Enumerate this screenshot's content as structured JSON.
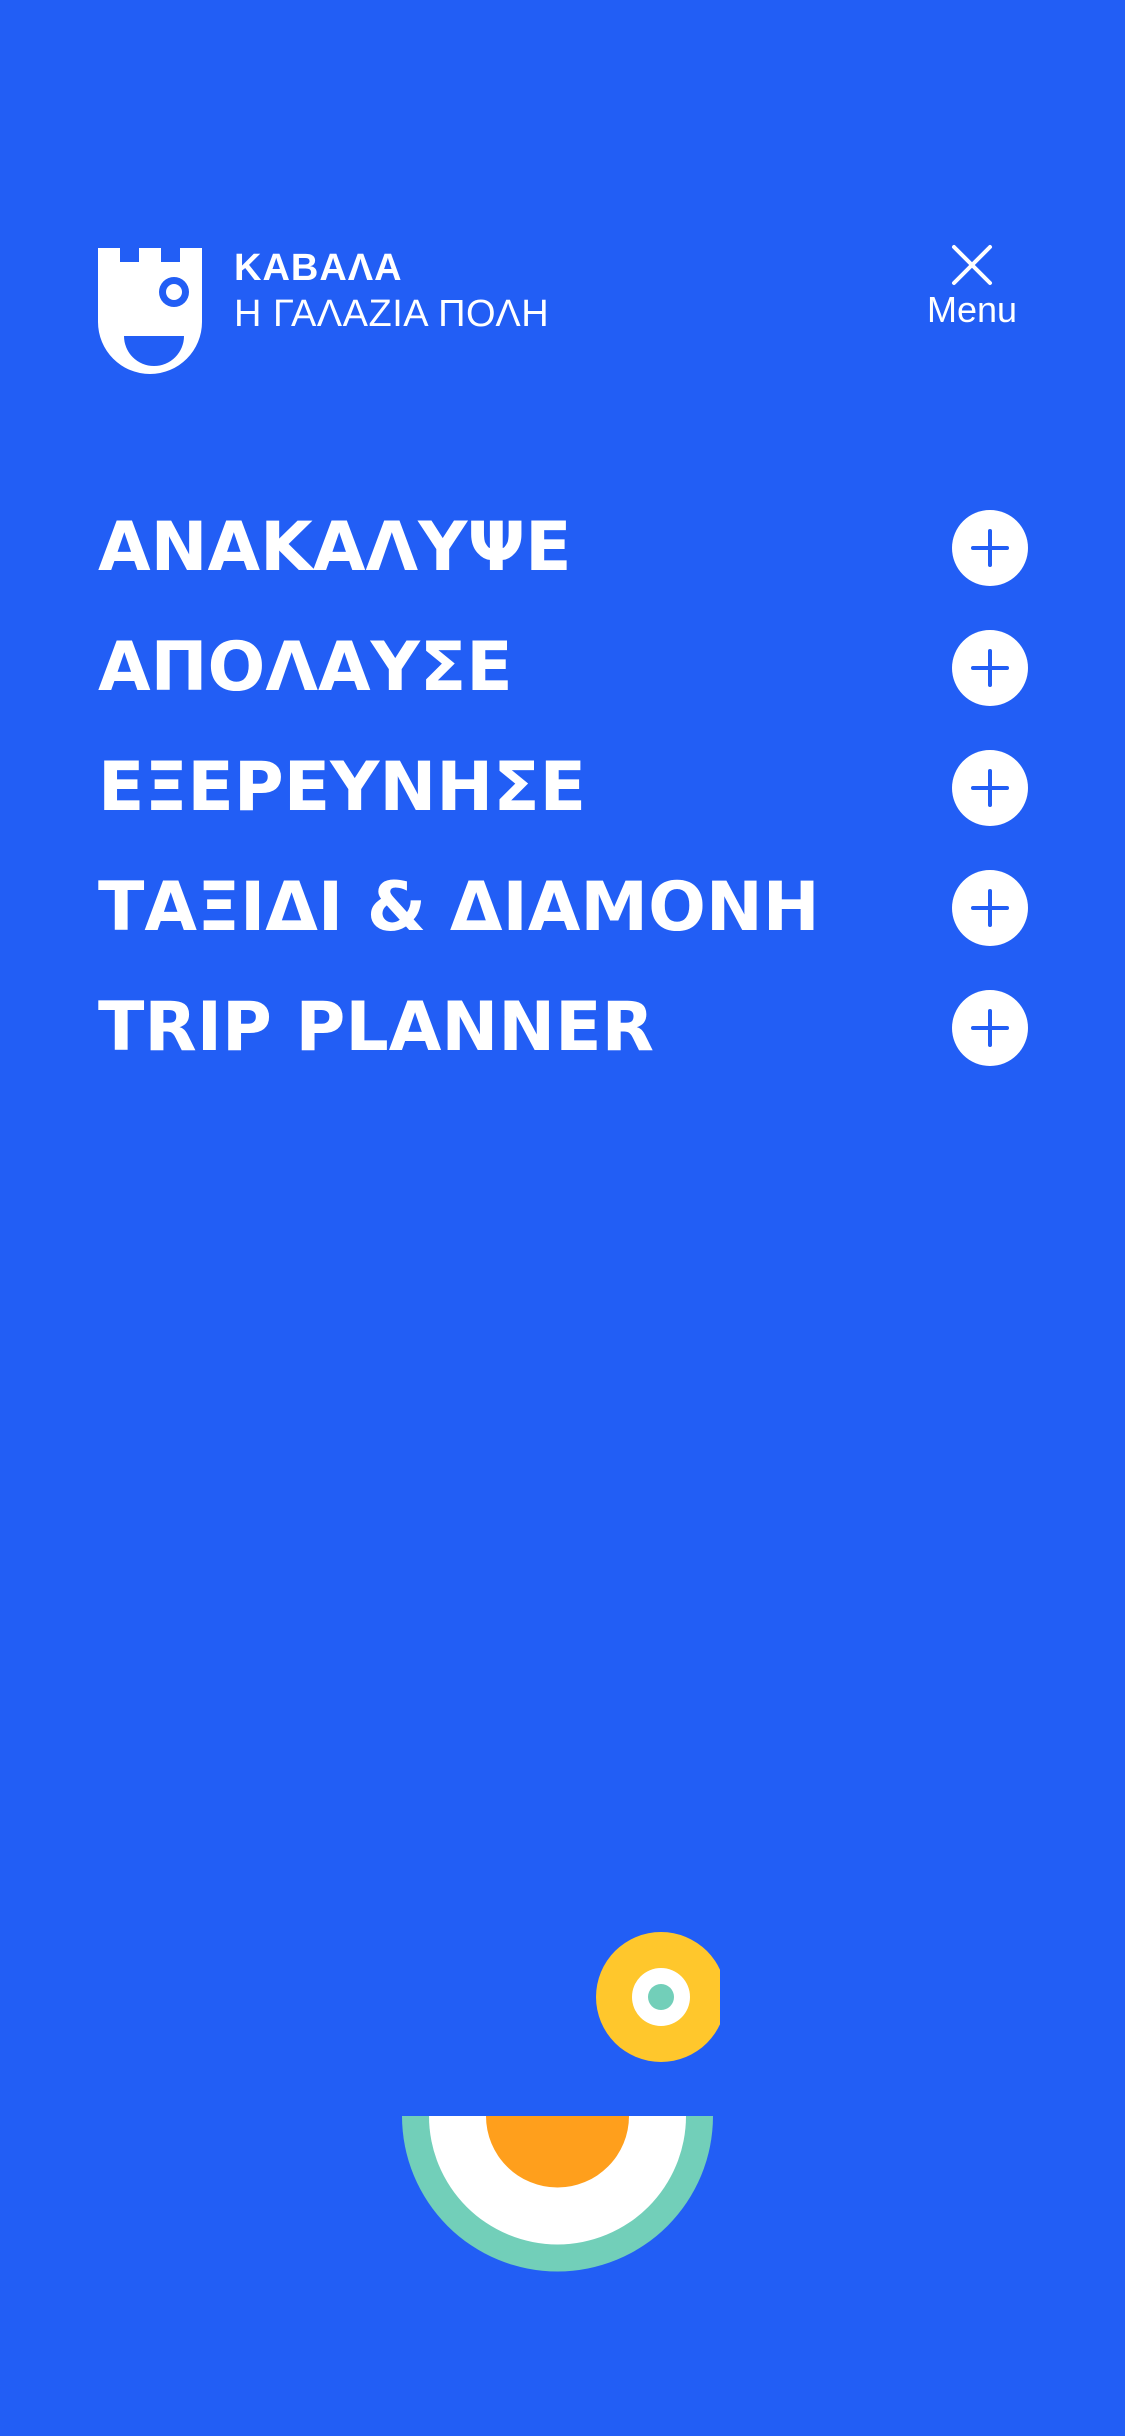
{
  "brand": {
    "title": "ΚΑΒΑΛΑ",
    "subtitle": "Η ΓΑΛΑΖΙΑ ΠΟΛΗ",
    "logo_icon": "castle-face-icon"
  },
  "menu_toggle": {
    "label": "Menu",
    "icon": "close-icon"
  },
  "nav": {
    "items": [
      {
        "label": "ΑΝΑΚΑΛΥΨΕ",
        "icon": "plus-icon"
      },
      {
        "label": "ΑΠΟΛΑΥΣΕ",
        "icon": "plus-icon"
      },
      {
        "label": "ΕΞΕΡΕΥΝΗΣΕ",
        "icon": "plus-icon"
      },
      {
        "label": "ΤΑΞΙΔΙ & ΔΙΑΜΟΝΗ",
        "icon": "plus-icon"
      },
      {
        "label": "TRIP PLANNER",
        "icon": "plus-icon"
      }
    ]
  },
  "colors": {
    "background": "#225ef5",
    "foreground": "#ffffff",
    "eye_yellow": "#ffc72c",
    "eye_pupil": "#72cfb9",
    "mouth_teal": "#72cfb9",
    "mouth_orange": "#ff9f1c"
  }
}
